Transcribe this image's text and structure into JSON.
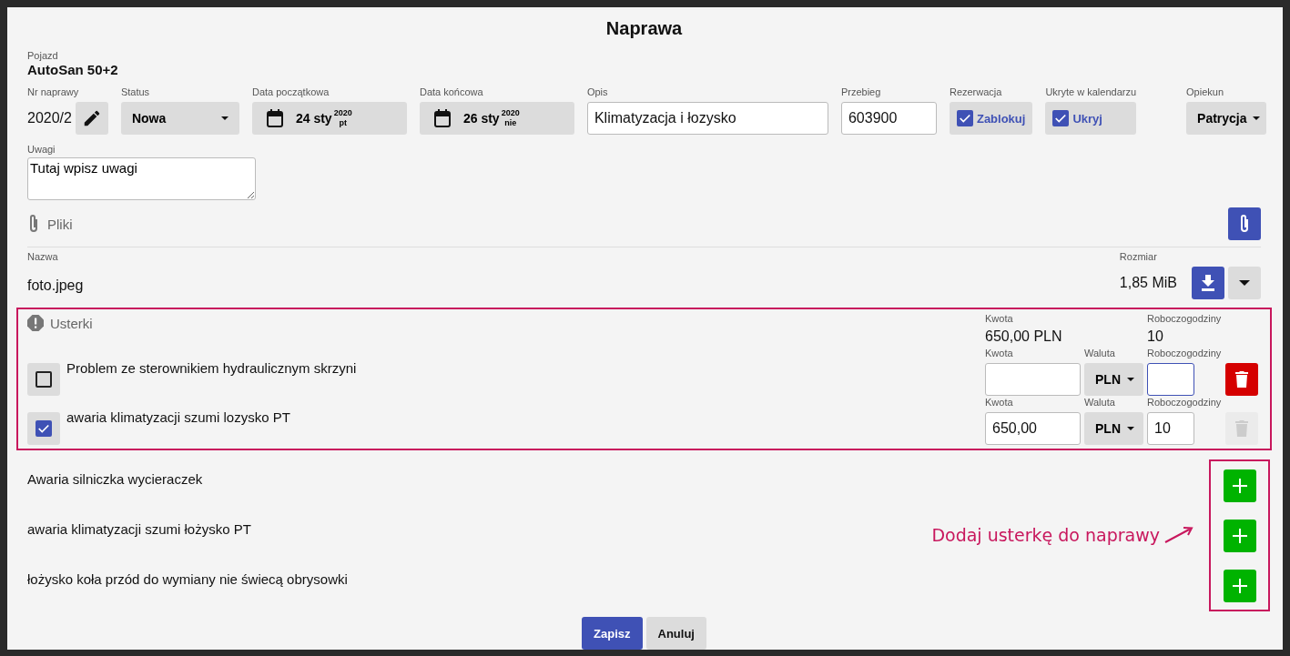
{
  "dialog": {
    "title": "Naprawa"
  },
  "vehicle": {
    "label": "Pojazd",
    "value": "AutoSan 50+2"
  },
  "fields": {
    "repair_no": {
      "label": "Nr naprawy",
      "value": "2020/2"
    },
    "status": {
      "label": "Status",
      "value": "Nowa"
    },
    "start_date": {
      "label": "Data początkowa",
      "day": "24 sty",
      "year": "2020",
      "weekday": "pt"
    },
    "end_date": {
      "label": "Data końcowa",
      "day": "26 sty",
      "year": "2020",
      "weekday": "nie"
    },
    "description": {
      "label": "Opis",
      "value": "Klimatyzacja i łozysko"
    },
    "mileage": {
      "label": "Przebieg",
      "value": "603900"
    },
    "reservation": {
      "label": "Rezerwacja",
      "option": "Zablokuj",
      "checked": true
    },
    "hidden": {
      "label": "Ukryte w kalendarzu",
      "option": "Ukryj",
      "checked": true
    },
    "caretaker": {
      "label": "Opiekun",
      "value": "Patrycja"
    }
  },
  "notes": {
    "label": "Uwagi",
    "value": "Tutaj wpisz uwagi"
  },
  "files": {
    "title": "Pliki",
    "columns": [
      "Nazwa",
      "Rozmiar"
    ],
    "rows": [
      {
        "name": "foto.jpeg",
        "size": "1,85 MiB"
      }
    ]
  },
  "defects": {
    "title": "Usterki",
    "total_label": "Kwota",
    "total": "650,00 PLN",
    "hours_label": "Roboczogodziny",
    "hours": "10",
    "items": [
      {
        "text": "Problem ze sterownikiem hydraulicznym skrzyni",
        "checked": false,
        "amount_label": "Kwota",
        "currency_label": "Waluta",
        "currency": "PLN",
        "hours_label": "Roboczogodziny",
        "focused": true,
        "delete_disabled": false
      },
      {
        "text": "awaria klimatyzacji szumi lozysko PT",
        "checked": true,
        "amount_label": "Kwota",
        "amount": "650,00",
        "currency_label": "Waluta",
        "currency": "PLN",
        "hours_label": "Roboczogodziny",
        "hours": "10",
        "focused": false,
        "delete_disabled": true
      }
    ]
  },
  "available_defects": [
    "Awaria silniczka wycieraczek",
    "awaria klimatyzacji szumi łożysko PT",
    "łożysko koła przód do wymiany nie świecą obrysowki"
  ],
  "annotation": {
    "label": "Dodaj usterkę do naprawy"
  },
  "buttons": {
    "save": "Zapisz",
    "cancel": "Anuluj"
  }
}
